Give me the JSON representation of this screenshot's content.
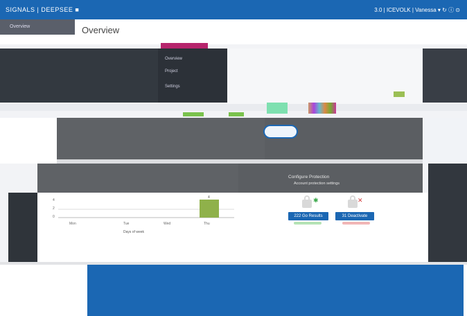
{
  "topbar": {
    "brand": "SIGNALS | DEEPSEE ■",
    "right_text": "3.0 | ICEVOLK | Vanessa ▾ ↻ ⓘ ⊙"
  },
  "sidebar": {
    "item": "Overview"
  },
  "page": {
    "title": "Overview"
  },
  "dropdown": {
    "items": [
      "Overview",
      "Project",
      "Settings"
    ]
  },
  "panel_middle": {
    "heading": "Configure Protection",
    "sub": "Account protection settings"
  },
  "chart": {
    "ylabel_ticks": [
      "4",
      "2",
      "0"
    ],
    "xlabel": "Days of week",
    "categories": [
      "Mon",
      "Tue",
      "Wed",
      "Thu"
    ],
    "bar_label": "4"
  },
  "buttons": {
    "pass": "222 Go Results",
    "fail": "31 Deactivate"
  },
  "colors": {
    "primary": "#1b67b3",
    "bar": "#8fb14a",
    "ok": "#3aa84a",
    "err": "#d23a3a"
  }
}
